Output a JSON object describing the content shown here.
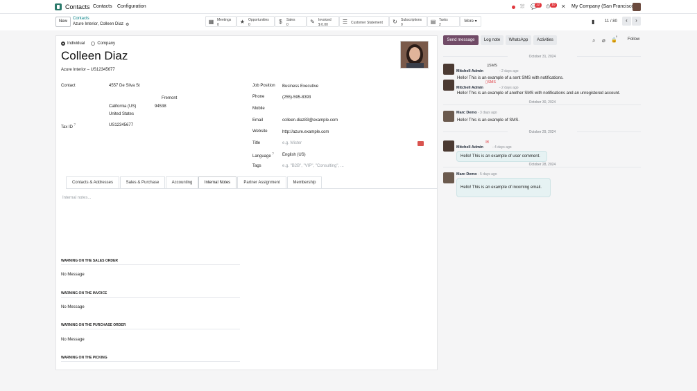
{
  "topnav": {
    "app_name": "Contacts",
    "menu": [
      "Contacts",
      "Configuration"
    ],
    "company": "My Company (San Francisco)",
    "badge_chat": "12",
    "badge_activity": "10"
  },
  "control": {
    "new_label": "New",
    "breadcrumb_parent": "Contacts",
    "breadcrumb_current": "Azure Interior, Colleen Diaz",
    "smart_buttons": [
      {
        "l1": "Meetings",
        "l2": "0",
        "icon": "calendar-icon"
      },
      {
        "l1": "Opportunities",
        "l2": "0",
        "icon": "star-icon"
      },
      {
        "l1": "Sales",
        "l2": "0",
        "icon": "dollar-icon"
      },
      {
        "l1": "Invoiced",
        "l2": "$ 0.00",
        "icon": "pencil-square-icon"
      },
      {
        "l1": "Customer Statement",
        "l2": "",
        "icon": "list-icon"
      },
      {
        "l1": "Subscriptions",
        "l2": "0",
        "icon": "refresh-icon"
      },
      {
        "l1": "Tasks",
        "l2": "2",
        "icon": "tasks-icon"
      }
    ],
    "more_label": "More ▾",
    "pager": "11 / 80"
  },
  "form": {
    "type_individual": "Individual",
    "type_company": "Company",
    "name": "Colleen Diaz",
    "company_line": "Azure Interior – US12345677",
    "contact_label": "Contact",
    "street": "4557 De Silva St",
    "city": "Fremont",
    "state": "California (US)",
    "zip": "94538",
    "country": "United States",
    "tax_label": "Tax ID",
    "tax_value": "US12345677",
    "job_label": "Job Position",
    "job_value": "Business Executive",
    "phone_label": "Phone",
    "phone_value": "(255)-595-8393",
    "mobile_label": "Mobile",
    "email_label": "Email",
    "email_value": "colleen.diaz83@example.com",
    "website_label": "Website",
    "website_value": "http://azure.example.com",
    "title_label": "Title",
    "title_placeholder": "e.g. Mister",
    "language_label": "Language",
    "language_value": "English (US)",
    "tags_label": "Tags",
    "tags_placeholder": "e.g. \"B2B\", \"VIP\", \"Consulting\", ...",
    "tabs": [
      "Contacts & Addresses",
      "Sales & Purchase",
      "Accounting",
      "Internal Notes",
      "Partner Assignment",
      "Membership"
    ],
    "notes_placeholder": "Internal notes...",
    "warnings": [
      {
        "title": "WARNING ON THE SALES ORDER",
        "value": "No Message"
      },
      {
        "title": "WARNING ON THE INVOICE",
        "value": "No Message"
      },
      {
        "title": "WARNING ON THE PURCHASE ORDER",
        "value": "No Message"
      },
      {
        "title": "WARNING ON THE PICKING",
        "value": "No Message"
      }
    ]
  },
  "chatter": {
    "send_message": "Send message",
    "log_note": "Log note",
    "whatsapp": "WhatsApp",
    "activities": "Activities",
    "follow": "Follow",
    "follower_count": "0",
    "dates": [
      "October 31, 2024",
      "October 30, 2024",
      "October 29, 2024",
      "October 28, 2024"
    ],
    "messages": [
      {
        "author": "Mitchell Admin",
        "time": "- 2 days ago",
        "tag": "SMS",
        "text": "Hello! This is an example of a sent SMS with notifications."
      },
      {
        "author": "Mitchell Admin",
        "time": "- 2 days ago",
        "tag": "SMS",
        "text": "Hello! This is an example of another SMS with notifications and an unregistered account."
      },
      {
        "author": "Marc Demo",
        "time": "- 3 days ago",
        "tag": "",
        "text": "Hello! This is an example of SMS."
      },
      {
        "author": "Mitchell Admin",
        "time": "- 4 days ago",
        "tag": "",
        "text": "Hello! This is an example of user comment."
      },
      {
        "author": "Marc Demo",
        "time": "- 5 days ago",
        "tag": "",
        "text": "Hello! This is an example of incoming email."
      }
    ]
  }
}
